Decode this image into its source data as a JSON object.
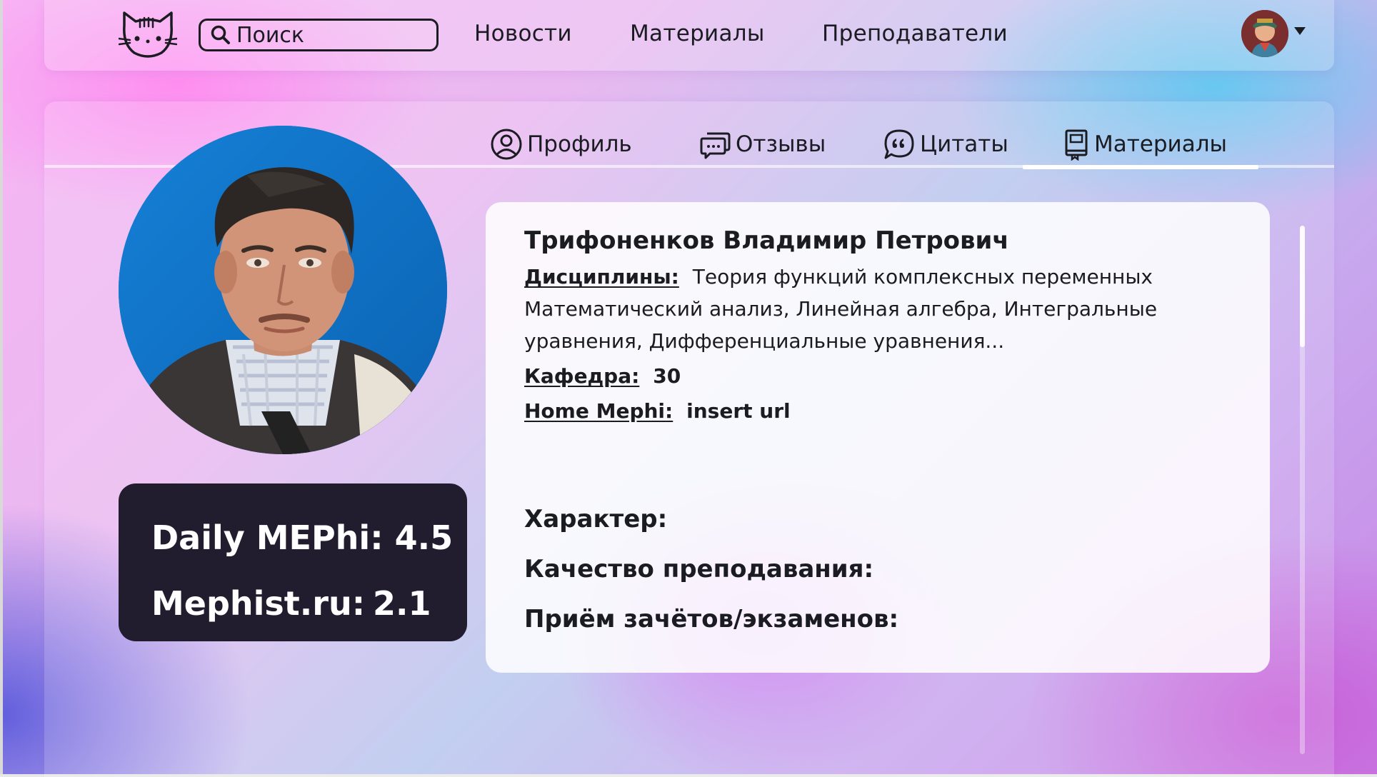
{
  "header": {
    "logo_icon": "cat-logo-icon",
    "search": {
      "placeholder": "Поиск",
      "value": ""
    },
    "nav": [
      {
        "label": "Новости"
      },
      {
        "label": "Материалы"
      },
      {
        "label": "Преподаватели"
      }
    ],
    "avatar_icon": "user-avatar",
    "menu_icon": "caret-down-icon"
  },
  "tabs": [
    {
      "label": "Профиль",
      "icon": "user-circle-icon"
    },
    {
      "label": "Отзывы",
      "icon": "chat-bubbles-icon"
    },
    {
      "label": "Цитаты",
      "icon": "quote-bubble-icon"
    },
    {
      "label": "Материалы",
      "icon": "book-icon"
    }
  ],
  "active_tab": "Материалы",
  "teacher": {
    "name": "Трифоненков Владимир Петрович",
    "disciplines_label": "Дисциплины:",
    "disciplines_value": "Теория функций комплексных переменных Математический анализ, Линейная алгебра, Интегральные уравнения, Дифференциальные уравнения...",
    "department_label": "Кафедра:",
    "department_value": "30",
    "homepage_label": "Home Mephi:",
    "homepage_value": "insert url"
  },
  "ratings": [
    {
      "source": "Daily MEPhi:",
      "value": "4.5"
    },
    {
      "source": "Mephist.ru:",
      "value": "2.1"
    }
  ],
  "criteria": [
    {
      "label": "Характер:"
    },
    {
      "label": "Качество преподавания:"
    },
    {
      "label": "Приём зачётов/экзаменов:"
    }
  ],
  "colors": {
    "text": "#1b1b22",
    "rating_card": "#211d2e",
    "photo_background": "#0f74c9"
  }
}
